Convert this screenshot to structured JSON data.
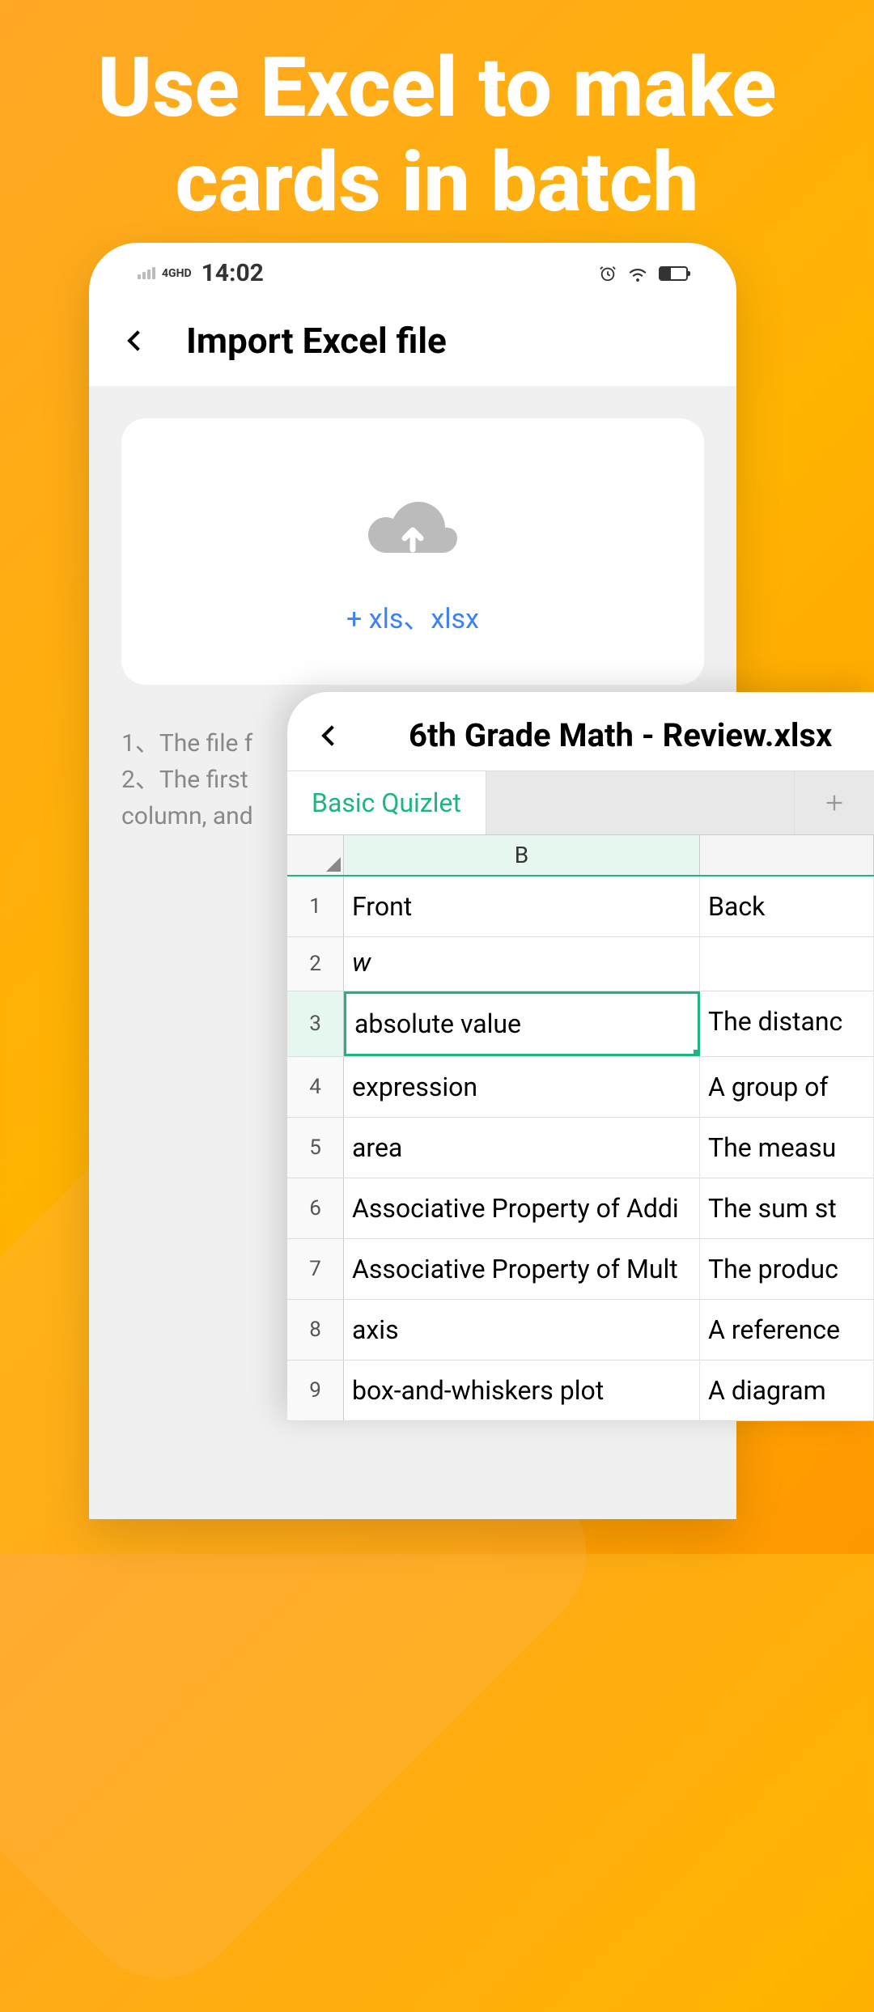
{
  "hero": {
    "title": "Use Excel to make cards in batch"
  },
  "statusBar": {
    "time": "14:02",
    "networkLabel": "4GHD"
  },
  "header": {
    "title": "Import Excel file"
  },
  "upload": {
    "formatText": "+ xls、xlsx"
  },
  "instructions": {
    "line1": "1、The file f",
    "line2": "2、The first",
    "line3": "column, and"
  },
  "spreadsheet": {
    "filename": "6th Grade Math - Review.xlsx",
    "tabName": "Basic Quizlet",
    "columns": {
      "b": "B"
    },
    "rows": [
      {
        "num": "1",
        "b": "Front",
        "c": "Back"
      },
      {
        "num": "2",
        "b": "w",
        "c": ""
      },
      {
        "num": "3",
        "b": "absolute value",
        "c": "The distanc"
      },
      {
        "num": "4",
        "b": "expression",
        "c": "A group of"
      },
      {
        "num": "5",
        "b": "area",
        "c": "The measu"
      },
      {
        "num": "6",
        "b": "Associative Property of Addi",
        "c": "The sum st"
      },
      {
        "num": "7",
        "b": "Associative Property of Mult",
        "c": "The produc"
      },
      {
        "num": "8",
        "b": "axis",
        "c": "A reference"
      },
      {
        "num": "9",
        "b": "box-and-whiskers plot",
        "c": "A diagram"
      }
    ]
  }
}
